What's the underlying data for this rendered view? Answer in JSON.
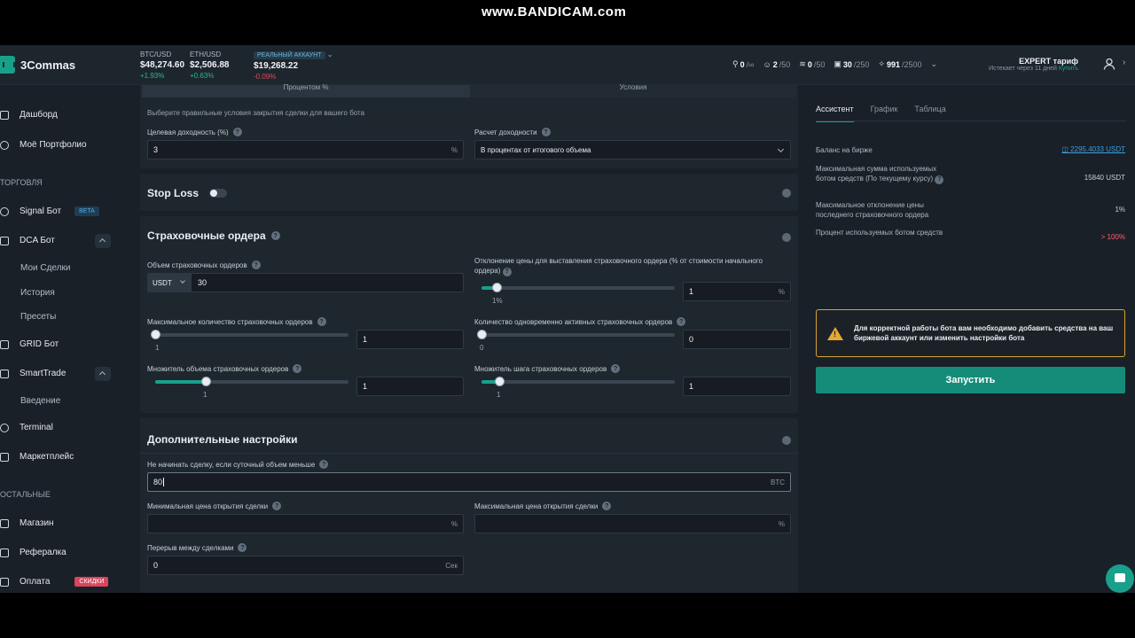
{
  "watermark": "www.BANDICAM.com",
  "header": {
    "logo": "3Commas",
    "tickers": [
      {
        "pair": "BTC/USD",
        "price": "$48,274.60",
        "change": "+1.93%"
      },
      {
        "pair": "ETH/USD",
        "price": "$2,506.88",
        "change": "+0.63%"
      }
    ],
    "account": {
      "label": "РЕАЛЬНЫЙ АККАУНТ",
      "balance": "$19,268.22",
      "change": "-0.09%"
    },
    "counters": [
      {
        "value": "0",
        "total": "/∞"
      },
      {
        "value": "2",
        "total": "/50"
      },
      {
        "value": "0",
        "total": "/50"
      },
      {
        "value": "30",
        "total": "/250"
      },
      {
        "value": "991",
        "total": "/2500"
      }
    ],
    "plan": {
      "title": "EXPERT тариф",
      "expires": "Истекает через 11 дней",
      "buy": "Купить"
    }
  },
  "sidebar": {
    "dashboard": "Дашборд",
    "portfolio": "Моё Портфолио",
    "trading_section": "ТОРГОВЛЯ",
    "signal_bot": "Signal Бот",
    "signal_badge": "BETA",
    "dca_bot": "DCA Бот",
    "my_deals": "Мои Сделки",
    "history": "История",
    "presets": "Пресеты",
    "grid_bot": "GRID Бот",
    "smarttrade": "SmartTrade",
    "intro": "Введение",
    "terminal": "Terminal",
    "marketplace": "Маркетплейс",
    "other_section": "ОСТАЛЬНЫЕ",
    "shop": "Магазин",
    "referral": "Рефералка",
    "payment": "Оплата",
    "payment_badge": "СКИДКИ"
  },
  "main": {
    "tabs": [
      "Процентом %",
      "Условия"
    ],
    "close_hint": "Выберите правильные условия закрытия сделки для вашего бота",
    "target_profit_label": "Целевая доходность (%)",
    "target_profit_value": "3",
    "target_profit_suffix": "%",
    "profit_calc_label": "Расчет доходности",
    "profit_calc_value": "В процентах от итогового объема",
    "stop_loss": "Stop Loss",
    "safety_orders": "Страховочные ордера",
    "so_volume_label": "Объем страховочных ордеров",
    "so_currency": "USDT",
    "so_volume_value": "30",
    "price_dev_label": "Отклонение цены для выставления страховочного ордера (% от стоимости начального ордера)",
    "price_dev_slider": "1%",
    "price_dev_value": "1",
    "price_dev_suffix": "%",
    "max_so_label": "Максимальное количество страховочных ордеров",
    "max_so_slider": "1",
    "max_so_value": "1",
    "active_so_label": "Количество одновременно активных страховочных ордеров",
    "active_so_slider": "0",
    "active_so_value": "0",
    "so_vol_scale_label": "Множитель объема страховочных ордеров",
    "so_vol_scale_slider": "1",
    "so_vol_scale_value": "1",
    "so_step_scale_label": "Множитель шага страховочных ордеров",
    "so_step_scale_slider": "1",
    "so_step_scale_value": "1",
    "advanced": "Дополнительные настройки",
    "min_volume_label": "Не начинать сделку, если суточный объем меньше",
    "min_volume_value": "80",
    "min_volume_suffix": "BTC",
    "min_price_label": "Минимальная цена открытия сделки",
    "min_price_suffix": "%",
    "max_price_label": "Максимальная цена открытия сделки",
    "max_price_suffix": "%",
    "cooldown_label": "Перерыв между сделками",
    "cooldown_value": "0",
    "cooldown_suffix": "Сек"
  },
  "right": {
    "tabs": [
      "Ассистент",
      "График",
      "Таблица"
    ],
    "balance_label": "Баланс на бирже",
    "balance_value": "2295.4033 USDT",
    "max_amount_label": "Максимальная сумма используемых ботом средств (По текущему курсу)",
    "max_amount_value": "15840 USDT",
    "max_dev_label": "Максимальное отклонение цены последнего страховочного ордера",
    "max_dev_value": "1%",
    "used_pct_label": "Процент используемых ботом средств",
    "used_pct_value": "> 100%",
    "warning": "Для корректной работы бота вам необходимо добавить средства на ваш биржевой аккаунт или изменить настройки бота",
    "start_button": "Запустить"
  },
  "sliders": {
    "price_dev_fraction": 0.08,
    "max_so_fraction": 0.0,
    "active_so_fraction": 0.0,
    "so_vol_scale_fraction": 0.26,
    "so_step_scale_fraction": 0.09
  },
  "colors": {
    "accent": "#19a08b",
    "warning": "#e7a72e",
    "negative": "#ff5c73",
    "link": "#3d9fe0"
  }
}
